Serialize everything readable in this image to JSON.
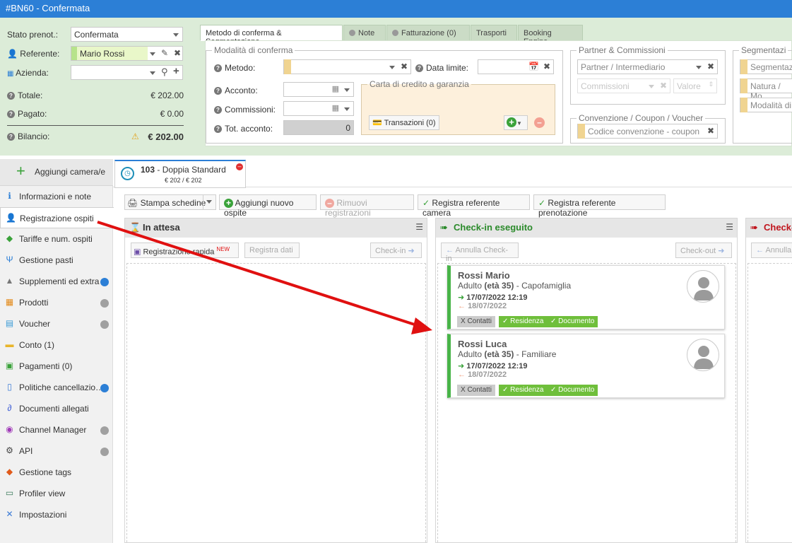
{
  "window_title": "#BN60 - Confermata",
  "summary": {
    "stato_label": "Stato prenot.:",
    "stato_value": "Confermata",
    "referente_label": "Referente:",
    "referente_value": "Mario Rossi",
    "azienda_label": "Azienda:",
    "azienda_value": "",
    "totale_label": "Totale:",
    "totale_value": "€ 202.00",
    "pagato_label": "Pagato:",
    "pagato_value": "€ 0.00",
    "bilancio_label": "Bilancio:",
    "bilancio_value": "€ 202.00"
  },
  "tabs": [
    {
      "label": "Metodo di conferma & Segmentazione"
    },
    {
      "label": "Note"
    },
    {
      "label": "Fatturazione (0)"
    },
    {
      "label": "Trasporti"
    },
    {
      "label": "Booking Engine"
    }
  ],
  "metodo": {
    "legend": "Modalità di conferma",
    "metodo_label": "Metodo:",
    "metodo_value": "",
    "data_limite_label": "Data limite:",
    "data_limite_value": "",
    "acconto_label": "Acconto:",
    "commissioni_label": "Commissioni:",
    "tot_acconto_label": "Tot. acconto:",
    "tot_acconto_value": "0",
    "carta_legend": "Carta di credito a garanzia",
    "transazioni_label": "Transazioni (0)"
  },
  "partner": {
    "legend": "Partner & Commissioni",
    "intermediario_placeholder": "Partner / Intermediario",
    "commissioni_placeholder": "Commissioni",
    "valore_placeholder": "Valore"
  },
  "convenzione": {
    "legend": "Convenzione / Coupon / Voucher",
    "codice_placeholder": "Codice convenzione - coupon"
  },
  "segmentazione": {
    "legend": "Segmentazi",
    "field1": "Segmentaz",
    "field2": "Natura / Mo",
    "field3": "Modalità di"
  },
  "sidebar": {
    "add_room": "Aggiungi camera/e",
    "items": [
      {
        "label": "Informazioni e note",
        "icon": "info-icon"
      },
      {
        "label": "Registrazione ospiti",
        "icon": "guest-icon"
      },
      {
        "label": "Tariffe e num. ospiti",
        "icon": "tag-icon"
      },
      {
        "label": "Gestione pasti",
        "icon": "cutlery-icon"
      },
      {
        "label": "Supplementi ed extra",
        "icon": "service-bell-icon"
      },
      {
        "label": "Prodotti",
        "icon": "boxes-icon"
      },
      {
        "label": "Voucher",
        "icon": "voucher-icon"
      },
      {
        "label": "Conto (1)",
        "icon": "folder-icon"
      },
      {
        "label": "Pagamenti (0)",
        "icon": "money-icon"
      },
      {
        "label": "Politiche cancellazio…",
        "icon": "document-icon"
      },
      {
        "label": "Documenti allegati",
        "icon": "paperclip-icon"
      },
      {
        "label": "Channel Manager",
        "icon": "broadcast-icon"
      },
      {
        "label": "API",
        "icon": "gear-icon"
      },
      {
        "label": "Gestione tags",
        "icon": "tags-icon"
      },
      {
        "label": "Profiler view",
        "icon": "monitor-icon"
      },
      {
        "label": "Impostazioni",
        "icon": "wrench-icon"
      }
    ]
  },
  "room_tab": {
    "number": "103",
    "separator": " - ",
    "type": "Doppia Standard",
    "price": "€ 202 / € 202"
  },
  "toolbar": {
    "stampa": "Stampa schedine",
    "aggiungi_ospite": "Aggiungi nuovo ospite",
    "rimuovi": "Rimuovi registrazioni",
    "ref_camera": "Registra referente camera",
    "ref_prenotazione": "Registra referente prenotazione"
  },
  "columns": {
    "attesa": {
      "title": "In attesa",
      "reg_rapida": "Registrazione rapida",
      "new_badge": "NEW",
      "reg_dati": "Registra dati",
      "checkin": "Check-in"
    },
    "eseguito": {
      "title": "Check-in eseguito",
      "annulla": "Annulla Check-in",
      "checkout": "Check-out"
    },
    "checkout": {
      "title": "Check-",
      "annulla": "Annulla"
    }
  },
  "guests": [
    {
      "name": "Rossi Mario",
      "role_prefix": "Adulto",
      "age": "(età 35)",
      "role": "- Capofamiglia",
      "arrival": "17/07/2022 12:19",
      "departure": "18/07/2022",
      "chips": [
        "X Contatti",
        "✓ Residenza",
        "✓ Documento"
      ]
    },
    {
      "name": "Rossi Luca",
      "role_prefix": "Adulto",
      "age": "(età 35)",
      "role": "- Familiare",
      "arrival": "17/07/2022 12:19",
      "departure": "18/07/2022",
      "chips": [
        "X Contatti",
        "✓ Residenza",
        "✓ Documento"
      ]
    }
  ],
  "colors": {
    "titlebar": "#2c7fd6",
    "top_bg": "#dcecd8",
    "card_accent": "#48b448",
    "chip_green": "#6fbf3b",
    "arrow": "#e01010"
  }
}
